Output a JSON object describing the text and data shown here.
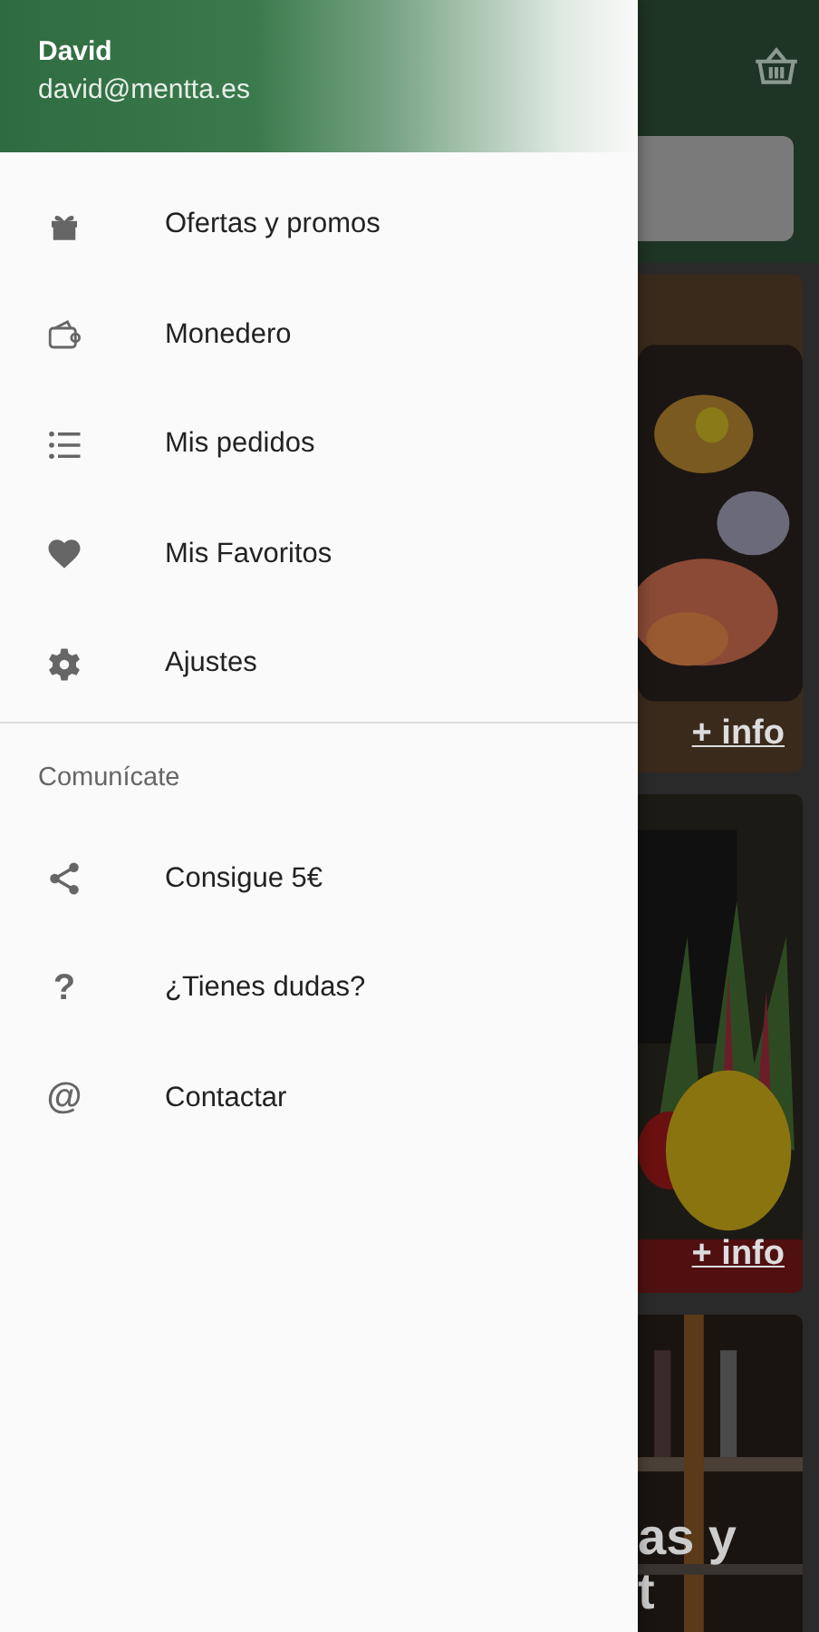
{
  "drawer": {
    "user": {
      "name": "David",
      "email": "david@mentta.es"
    },
    "items": [
      {
        "label": "Ofertas y promos"
      },
      {
        "label": "Monedero"
      },
      {
        "label": "Mis pedidos"
      },
      {
        "label": "Mis Favoritos"
      },
      {
        "label": "Ajustes"
      }
    ],
    "section": {
      "title": "Comunícate",
      "items": [
        {
          "label": "Consigue 5€"
        },
        {
          "label": "¿Tienes dudas?",
          "glyph": "?"
        },
        {
          "label": "Contactar",
          "glyph": "@"
        }
      ]
    }
  },
  "background": {
    "cards": [
      {
        "kind": "food",
        "link": "+ info"
      },
      {
        "kind": "veg",
        "link": "+ info"
      },
      {
        "kind": "wine",
        "title_lines": [
          "as y",
          "t"
        ]
      }
    ]
  }
}
